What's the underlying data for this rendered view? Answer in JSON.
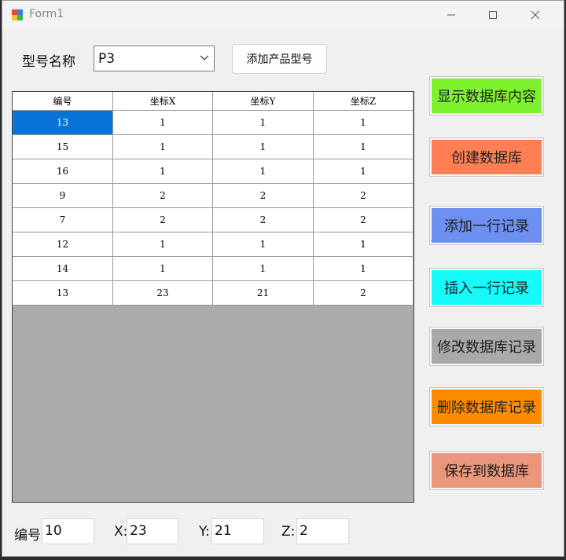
{
  "window": {
    "title": "Form1"
  },
  "form": {
    "model_label": "型号名称",
    "model_value": "P3",
    "add_type_button": "添加产品型号"
  },
  "grid": {
    "columns": [
      "编号",
      "坐标X",
      "坐标Y",
      "坐标Z"
    ],
    "rows": [
      [
        "13",
        "1",
        "1",
        "1"
      ],
      [
        "15",
        "1",
        "1",
        "1"
      ],
      [
        "16",
        "1",
        "1",
        "1"
      ],
      [
        "9",
        "2",
        "2",
        "2"
      ],
      [
        "7",
        "2",
        "2",
        "2"
      ],
      [
        "12",
        "1",
        "1",
        "1"
      ],
      [
        "14",
        "1",
        "1",
        "1"
      ],
      [
        "13",
        "23",
        "21",
        "2"
      ]
    ],
    "selected_cell": "row 1, column 编号"
  },
  "buttons": [
    {
      "label": "显示数据库内容",
      "color": "#7ff22e"
    },
    {
      "label": "创建数据库",
      "color": "#ff7f55"
    },
    {
      "label": "添加一行记录",
      "color": "#6c8ff0"
    },
    {
      "label": "插入一行记录",
      "color": "#17fafa"
    },
    {
      "label": "修改数据库记录",
      "color": "#a9a9a9"
    },
    {
      "label": "删除数据库记录",
      "color": "#ff8c00"
    },
    {
      "label": "保存到数据库",
      "color": "#e9967a"
    }
  ],
  "fields": {
    "id_label": "编号",
    "id_value": "10",
    "x_label": "X:",
    "x_value": "23",
    "y_label": "Y:",
    "y_value": "21",
    "z_label": "Z:",
    "z_value": "2"
  },
  "colors": {
    "selection": "#0a74d6",
    "grid_background": "#ababab"
  }
}
